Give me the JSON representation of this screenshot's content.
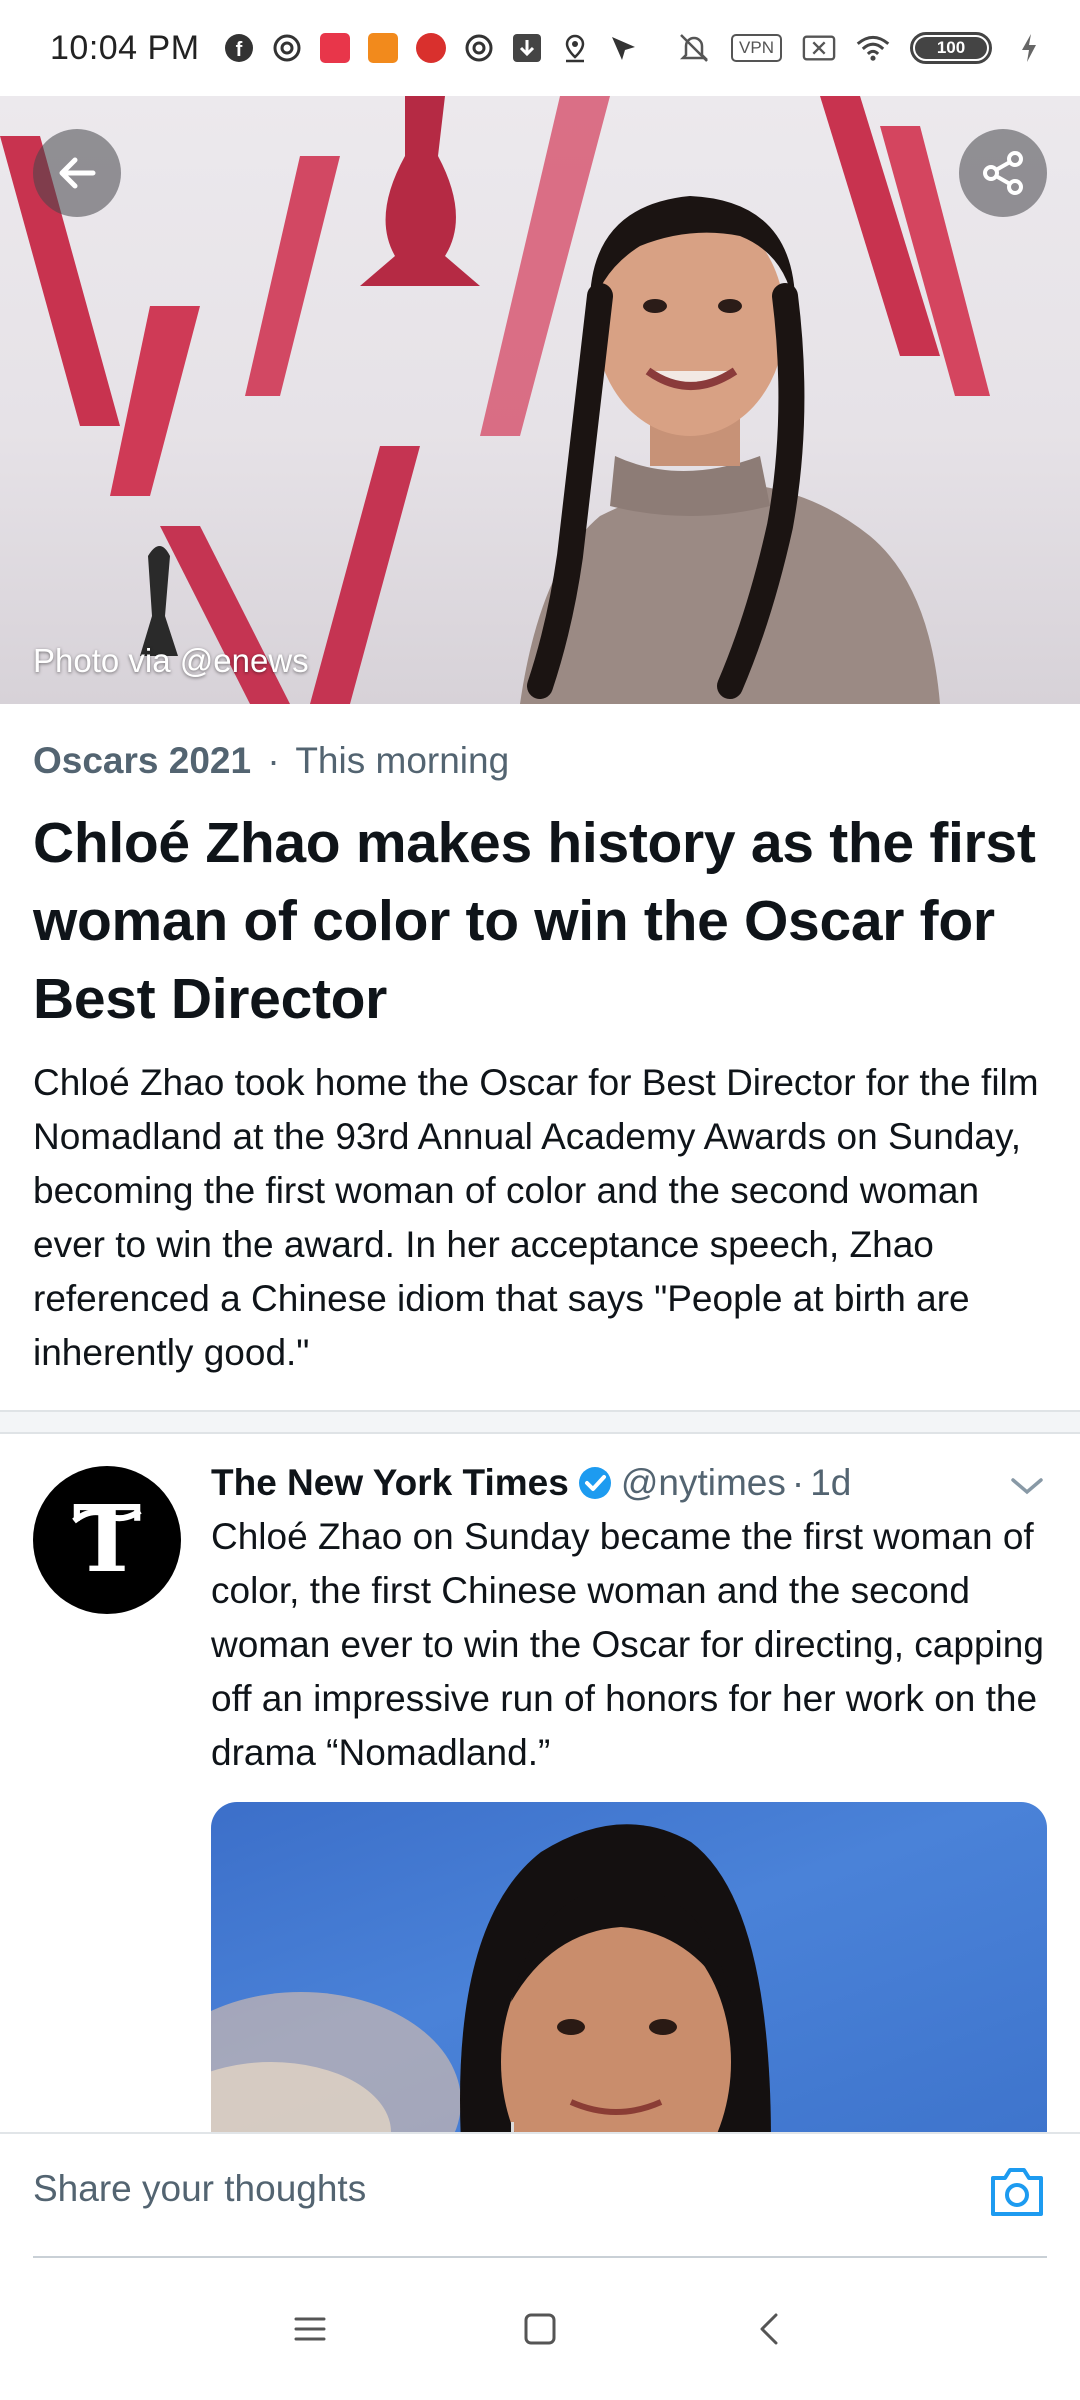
{
  "status_bar": {
    "time": "10:04 PM",
    "left_icons": [
      "facebook-icon",
      "at-sign-icon",
      "app-red-icon",
      "app-orange-icon",
      "app-red-seal-icon",
      "at-sign-icon",
      "download-icon",
      "location-pin-icon",
      "send-icon"
    ],
    "vpn_label": "VPN",
    "battery_level": "100"
  },
  "hero": {
    "photo_credit": "Photo via @enews"
  },
  "article": {
    "topic": "Oscars 2021",
    "separator": "·",
    "time": "This morning",
    "headline": "Chloé Zhao makes history as the first woman of color to win the Oscar for Best Director",
    "summary": "Chloé Zhao took home the Oscar for Best Director for the film Nomadland at the 93rd Annual Academy Awards on Sunday, becoming the first woman of color and the second woman ever to win the award. In her acceptance speech, Zhao referenced a Chinese idiom that says \"People at birth are inherently good.\""
  },
  "tweet": {
    "author_name": "The New York Times",
    "handle": "@nytimes",
    "separator": "·",
    "age": "1d",
    "text": "Chloé Zhao on Sunday became the first woman of color, the first Chinese woman and the second woman ever to win the Oscar for directing, capping off an impressive run of honors for her work on the drama “Nomadland.”"
  },
  "reply": {
    "placeholder": "Share your thoughts"
  },
  "colors": {
    "accent": "#1d9bf0",
    "secondary_text": "#536471",
    "oscar_red": "#c8334f"
  }
}
